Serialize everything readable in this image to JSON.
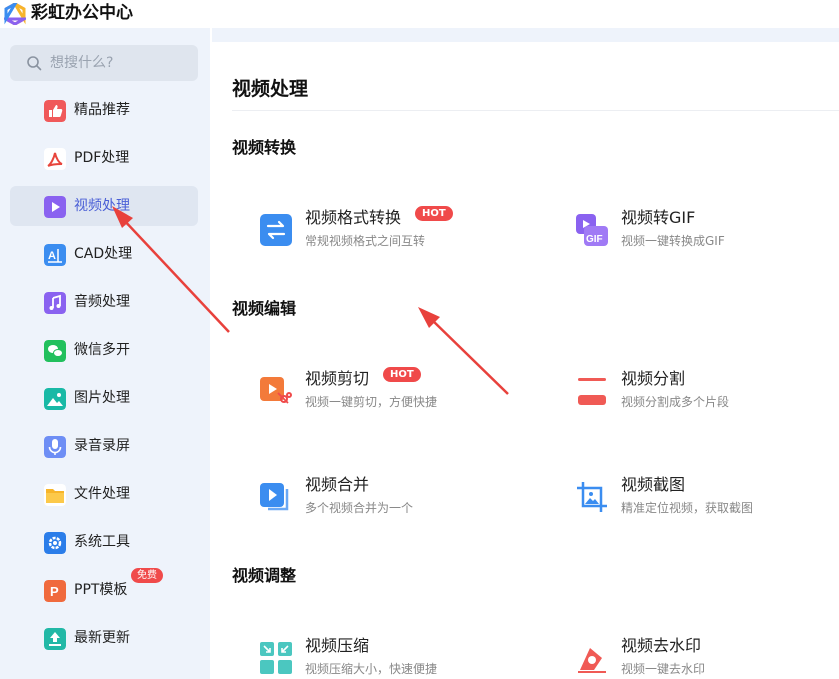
{
  "app": {
    "title": "彩虹办公中心"
  },
  "search": {
    "placeholder": "想搜什么?"
  },
  "sidebar": {
    "items": [
      {
        "label": "精品推荐",
        "icon": "thumbs-up-icon",
        "color": "#f0595a"
      },
      {
        "label": "PDF处理",
        "icon": "pdf-icon",
        "color": "#e8453c"
      },
      {
        "label": "视频处理",
        "icon": "play-icon",
        "color": "#8a62f0",
        "active": true
      },
      {
        "label": "CAD处理",
        "icon": "cad-icon",
        "color": "#3b8df0"
      },
      {
        "label": "音频处理",
        "icon": "music-note-icon",
        "color": "#8a62f0"
      },
      {
        "label": "微信多开",
        "icon": "wechat-icon",
        "color": "#22c05d"
      },
      {
        "label": "图片处理",
        "icon": "image-icon",
        "color": "#19b9a6"
      },
      {
        "label": "录音录屏",
        "icon": "microphone-icon",
        "color": "#6e8ef5"
      },
      {
        "label": "文件处理",
        "icon": "folder-icon",
        "color": "#f7b52a"
      },
      {
        "label": "系统工具",
        "icon": "gear-icon",
        "color": "#2b7de9"
      },
      {
        "label": "PPT模板",
        "icon": "ppt-icon",
        "color": "#f06a3d",
        "badge": "免费"
      },
      {
        "label": "最新更新",
        "icon": "upload-icon",
        "color": "#22b8a6"
      }
    ]
  },
  "main": {
    "title": "视频处理",
    "sections": [
      {
        "title": "视频转换",
        "tools": [
          {
            "name": "视频格式转换",
            "desc": "常规视频格式之间互转",
            "badge": "HOT",
            "icon": "swap-arrows-icon"
          },
          {
            "name": "视频转GIF",
            "desc": "视频一键转换成GIF",
            "icon": "gif-icon"
          }
        ]
      },
      {
        "title": "视频编辑",
        "tools": [
          {
            "name": "视频剪切",
            "desc": "视频一键剪切，方便快捷",
            "badge": "HOT",
            "icon": "video-scissors-icon"
          },
          {
            "name": "视频分割",
            "desc": "视频分割成多个片段",
            "icon": "split-icon"
          },
          {
            "name": "视频合并",
            "desc": "多个视频合并为一个",
            "icon": "merge-icon"
          },
          {
            "name": "视频截图",
            "desc": "精准定位视频，获取截图",
            "icon": "crop-image-icon"
          }
        ]
      },
      {
        "title": "视频调整",
        "tools": [
          {
            "name": "视频压缩",
            "desc": "视频压缩大小，快速便捷",
            "icon": "compress-icon"
          },
          {
            "name": "视频去水印",
            "desc": "视频一键去水印",
            "icon": "watermark-eraser-icon"
          }
        ]
      }
    ]
  },
  "colors": {
    "accent": "#4a5fd6",
    "hot": "#f04a4a",
    "arrow": "#e8413c",
    "sidebar_bg": "#eef3fb"
  }
}
